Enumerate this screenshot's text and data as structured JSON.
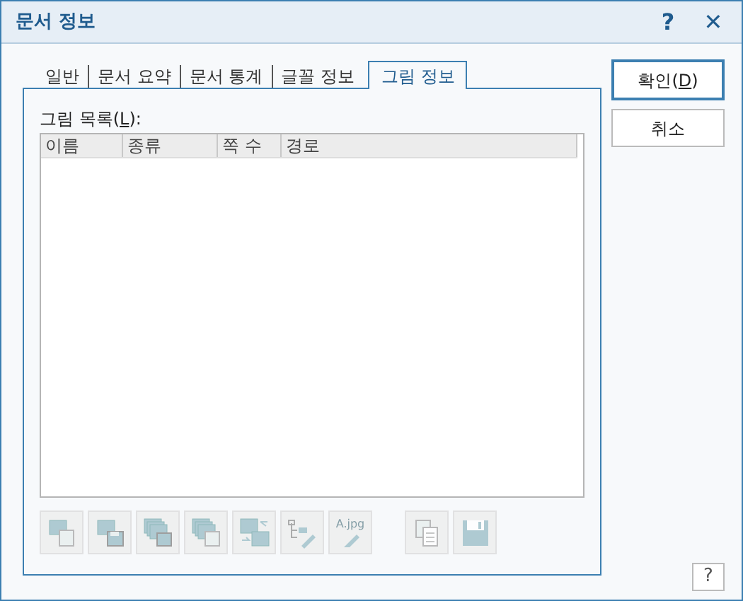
{
  "window": {
    "title": "문서 정보",
    "help": "?",
    "close": "✕"
  },
  "tabs": [
    {
      "label": "일반",
      "selected": false
    },
    {
      "label": "문서 요약",
      "selected": false
    },
    {
      "label": "문서 통계",
      "selected": false
    },
    {
      "label": "글꼴 정보",
      "selected": false
    },
    {
      "label": "그림 정보",
      "selected": true
    }
  ],
  "list": {
    "label": "그림 목록(",
    "mnemonic": "L",
    "label_end": "):",
    "columns": [
      "이름",
      "종류",
      "쪽 수",
      "경로"
    ]
  },
  "tools": [
    {
      "kind": "extract",
      "disabled": true
    },
    {
      "kind": "save",
      "disabled": true
    },
    {
      "kind": "save-all",
      "disabled": true
    },
    {
      "kind": "extract-all",
      "disabled": true
    },
    {
      "kind": "replace",
      "disabled": true
    },
    {
      "kind": "tree-edit",
      "disabled": true
    },
    {
      "kind": "rename",
      "label": "A.jpg",
      "disabled": true
    },
    {
      "kind": "gap"
    },
    {
      "kind": "copy",
      "disabled": true
    },
    {
      "kind": "disk",
      "disabled": true
    }
  ],
  "buttons": [
    {
      "label": "확인(",
      "mnemonic": "D",
      "label_end": ")",
      "default": true
    },
    {
      "label": "취소",
      "default": false
    }
  ],
  "corner_help": "?"
}
